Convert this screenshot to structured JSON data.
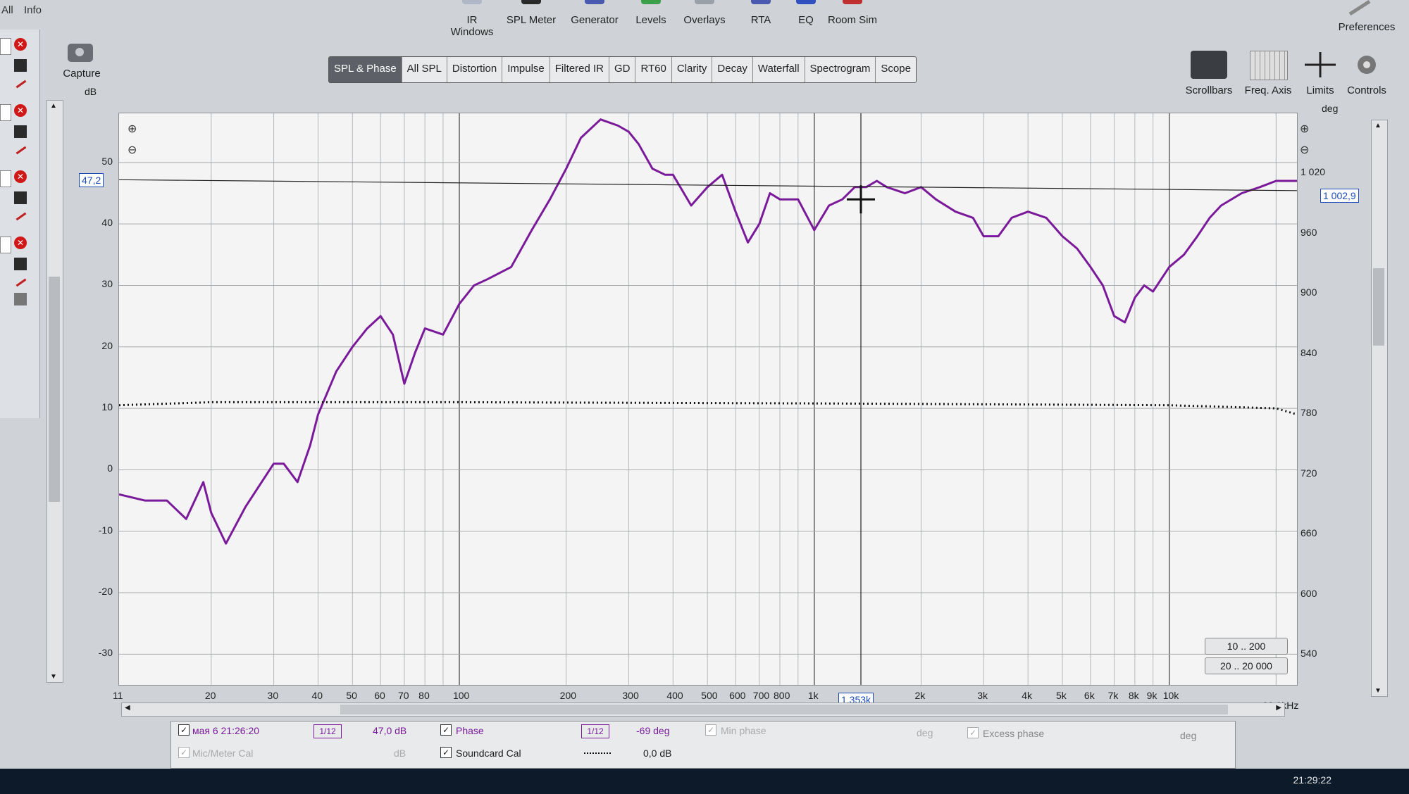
{
  "menu": {
    "all": "All",
    "info": "Info"
  },
  "toolbar": [
    {
      "label": "IR Windows",
      "icon": "ir-windows-icon",
      "color": "#b0b8c8"
    },
    {
      "label": "SPL Meter",
      "icon": "spl-meter-icon",
      "color": "#2a2a2a"
    },
    {
      "label": "Generator",
      "icon": "generator-icon",
      "color": "#4a5ab0"
    },
    {
      "label": "Levels",
      "icon": "levels-icon",
      "color": "#3aa04a"
    },
    {
      "label": "Overlays",
      "icon": "overlays-icon",
      "color": "#9aa0a8"
    },
    {
      "label": "RTA",
      "icon": "rta-icon",
      "color": "#4a5ab0"
    },
    {
      "label": "EQ",
      "icon": "eq-icon",
      "color": "#3050c0"
    },
    {
      "label": "Room Sim",
      "icon": "room-sim-icon",
      "color": "#c03030"
    }
  ],
  "preferences": "Preferences",
  "capture": {
    "label": "Capture"
  },
  "tabs": [
    "SPL & Phase",
    "All SPL",
    "Distortion",
    "Impulse",
    "Filtered IR",
    "GD",
    "RT60",
    "Clarity",
    "Decay",
    "Waterfall",
    "Spectrogram",
    "Scope"
  ],
  "active_tab": "SPL & Phase",
  "right_toolbar": [
    {
      "label": "Scrollbars",
      "icon": "scrollbars-icon"
    },
    {
      "label": "Freq. Axis",
      "icon": "freq-axis-icon"
    },
    {
      "label": "Limits",
      "icon": "limits-icon"
    },
    {
      "label": "Controls",
      "icon": "controls-gear-icon"
    }
  ],
  "graph": {
    "left_unit": "dB",
    "right_unit": "deg",
    "left_marker": "47,2",
    "right_marker": "1 002,9",
    "cursor_freq": "1,353k",
    "end_freq": "22,9kHz",
    "range_buttons": [
      "10 .. 200",
      "20 .. 20 000"
    ]
  },
  "chart_data": {
    "type": "line",
    "y_left": {
      "label": "dB",
      "range": [
        -35,
        58
      ],
      "ticks": [
        "50",
        "40",
        "30",
        "20",
        "10",
        "0",
        "-10",
        "-20",
        "-30"
      ]
    },
    "y_right": {
      "label": "deg",
      "range": [
        510,
        1080
      ],
      "ticks": [
        "1 020",
        "960",
        "900",
        "840",
        "780",
        "720",
        "660",
        "600",
        "540"
      ]
    },
    "x_axis": {
      "scale": "log",
      "range_hz": [
        11,
        22900
      ],
      "tick_labels": [
        "11",
        "20",
        "30",
        "40",
        "50",
        "60",
        "70",
        "80",
        "100",
        "200",
        "300",
        "400",
        "500",
        "600",
        "700",
        "800",
        "1k",
        "2k",
        "3k",
        "4k",
        "5k",
        "6k",
        "7k",
        "8k",
        "9k",
        "10k"
      ]
    },
    "series": [
      {
        "name": "мая 6 21:26:20",
        "color": "#7a1a9a",
        "x": [
          11,
          13,
          15,
          17,
          19,
          20,
          22,
          25,
          30,
          32,
          35,
          38,
          40,
          45,
          50,
          55,
          60,
          65,
          70,
          75,
          80,
          90,
          100,
          110,
          120,
          140,
          160,
          180,
          200,
          220,
          250,
          280,
          300,
          320,
          350,
          380,
          400,
          450,
          500,
          550,
          600,
          650,
          700,
          750,
          800,
          900,
          1000,
          1100,
          1200,
          1300,
          1400,
          1500,
          1600,
          1800,
          2000,
          2200,
          2500,
          2800,
          3000,
          3300,
          3600,
          4000,
          4500,
          5000,
          5500,
          6000,
          6500,
          7000,
          7500,
          8000,
          8500,
          9000,
          10000,
          11000,
          12000,
          13000,
          14000,
          16000,
          18000,
          20000,
          22900
        ],
        "y": [
          -4,
          -5,
          -5,
          -8,
          -2,
          -7,
          -12,
          -6,
          1,
          1,
          -2,
          4,
          9,
          16,
          20,
          23,
          25,
          22,
          14,
          19,
          23,
          22,
          27,
          30,
          31,
          33,
          39,
          44,
          49,
          54,
          57,
          56,
          55,
          53,
          49,
          48,
          48,
          43,
          46,
          48,
          42,
          37,
          40,
          45,
          44,
          44,
          39,
          43,
          44,
          46,
          46,
          47,
          46,
          45,
          46,
          44,
          42,
          41,
          38,
          38,
          41,
          42,
          41,
          38,
          36,
          33,
          30,
          25,
          24,
          28,
          30,
          29,
          33,
          35,
          38,
          41,
          43,
          45,
          46,
          47,
          47
        ]
      },
      {
        "name": "Soundcard Cal",
        "color": "#111111",
        "x": [
          11,
          20,
          50,
          100,
          1000,
          10000,
          20000,
          22900
        ],
        "y": [
          10.5,
          11,
          11,
          11,
          10.8,
          10.5,
          10,
          9
        ]
      }
    ]
  },
  "legend": {
    "row1": {
      "measurement": "мая 6 21:26:20",
      "smoothing": "1/12",
      "level": "47,0 dB",
      "phase_label": "Phase",
      "phase_smoothing": "1/12",
      "phase_value": "-69 deg",
      "minphase": "Min phase",
      "deg1": "deg",
      "excess": "Excess phase",
      "deg2": "deg"
    },
    "row2": {
      "mic": "Mic/Meter Cal",
      "db": "dB",
      "soundcard": "Soundcard Cal",
      "cal_value": "0,0 dB"
    }
  },
  "taskbar": {
    "time": "21:29:22"
  },
  "colors": {
    "spl": "#7a1a9a",
    "accent": "#1a4bb8"
  }
}
